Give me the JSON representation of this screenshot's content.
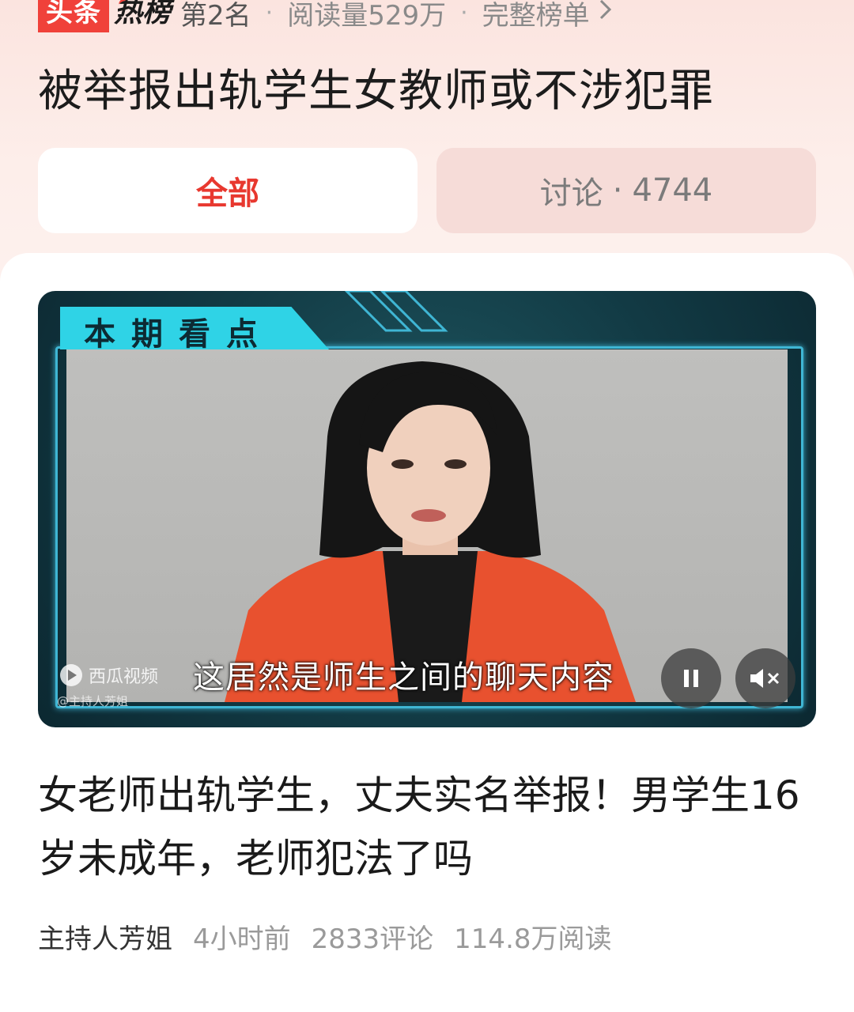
{
  "header": {
    "logo_toutiao": "头条",
    "logo_rebang": "热榜",
    "rank": "第2名",
    "reads": "阅读量529万",
    "full_list": "完整榜单",
    "separator": "·"
  },
  "headline": "被举报出轨学生女教师或不涉犯罪",
  "tabs": [
    {
      "label": "全部",
      "active": true
    },
    {
      "label": "讨论",
      "count": "4744",
      "active": false
    }
  ],
  "video": {
    "banner": "本期看点",
    "subtitle": "这居然是师生之间的聊天内容",
    "platform": "西瓜视频",
    "watermark": "@主持人芳姐",
    "controls": {
      "pause_icon": "pause-icon",
      "mute_icon": "mute-icon"
    }
  },
  "article": {
    "title": "女老师出轨学生，丈夫实名举报！男学生16岁未成年，老师犯法了吗",
    "author": "主持人芳姐",
    "time": "4小时前",
    "comments": "2833评论",
    "reads": "114.8万阅读"
  },
  "colors": {
    "accent": "#e8382f",
    "header_bg": "#fbe4df",
    "banner_cyan": "#2fd3e6",
    "jacket": "#e8512f"
  }
}
